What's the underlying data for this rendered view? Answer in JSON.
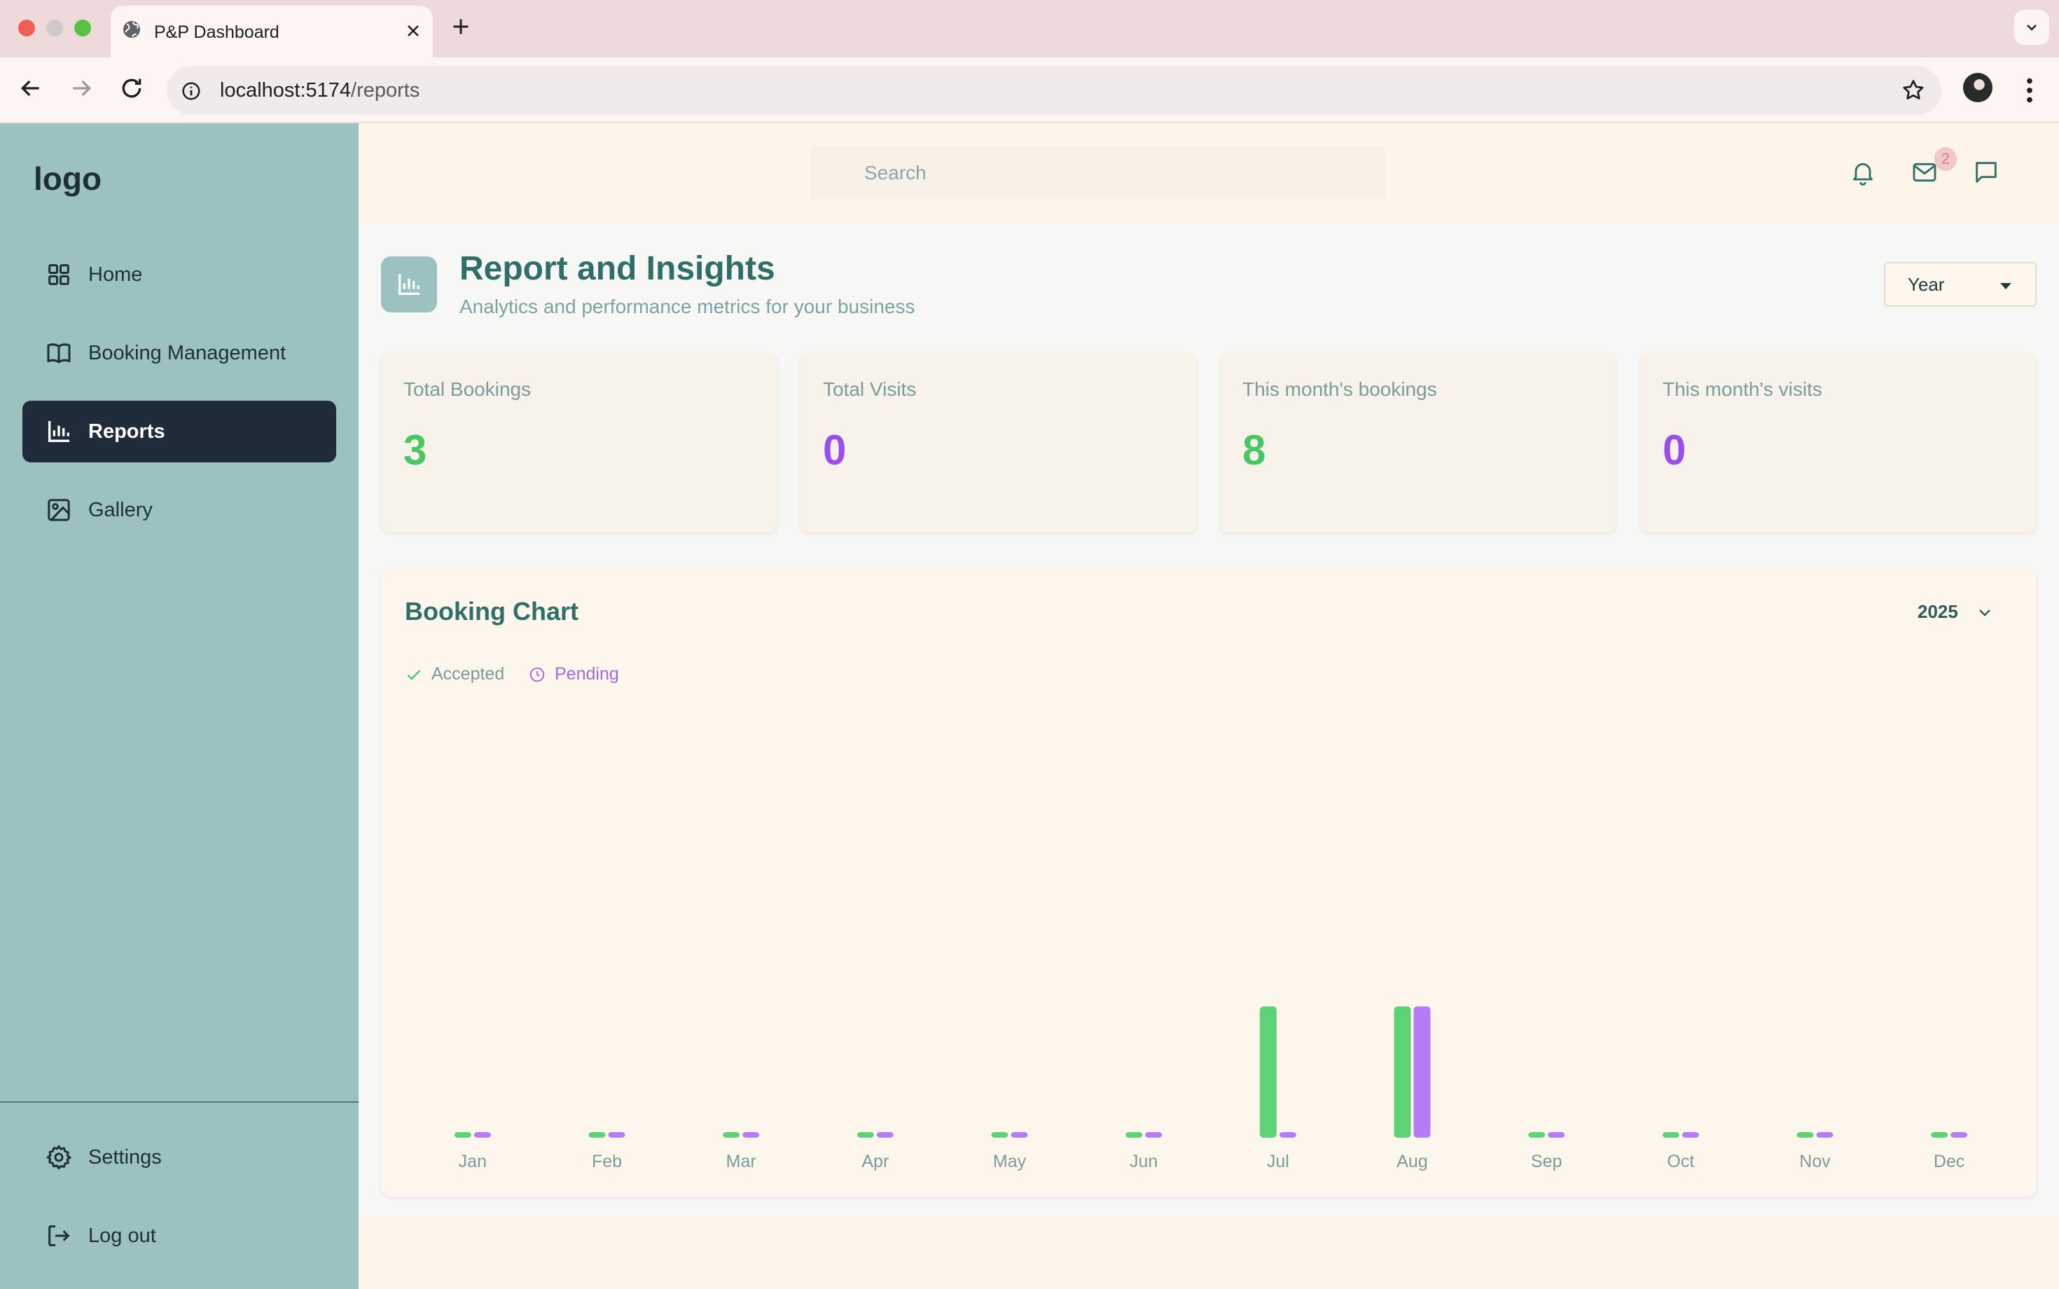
{
  "browser": {
    "tab_title": "P&P Dashboard",
    "url_host": "localhost:5174",
    "url_path": "/reports"
  },
  "sidebar": {
    "logo": "logo",
    "items": [
      {
        "label": "Home",
        "icon": "grid-icon"
      },
      {
        "label": "Booking Management",
        "icon": "book-icon"
      },
      {
        "label": "Reports",
        "icon": "bar-chart-icon",
        "active": true
      },
      {
        "label": "Gallery",
        "icon": "image-icon"
      }
    ],
    "bottom_items": [
      {
        "label": "Settings",
        "icon": "gear-icon"
      },
      {
        "label": "Log out",
        "icon": "logout-icon"
      }
    ]
  },
  "header": {
    "search_placeholder": "Search",
    "mail_badge": "2"
  },
  "page": {
    "title": "Report and Insights",
    "subtitle": "Analytics and performance metrics for your business",
    "period_select": "Year"
  },
  "stats": [
    {
      "label": "Total Bookings",
      "value": "3",
      "color": "#4cc663"
    },
    {
      "label": "Total Visits",
      "value": "0",
      "color": "#9a4ef0"
    },
    {
      "label": "This month's bookings",
      "value": "8",
      "color": "#4cc663"
    },
    {
      "label": "This month's visits",
      "value": "0",
      "color": "#9a4ef0"
    }
  ],
  "booking_chart": {
    "title": "Booking Chart",
    "year": "2025"
  },
  "colors": {
    "accepted": "#5cd376",
    "pending": "#b57cf5",
    "sidebar": "#9bc2c1",
    "active_nav": "#1f2b38",
    "heading": "#2f6f67"
  },
  "chart_data": {
    "type": "bar",
    "title": "",
    "categories": [
      "Jan",
      "Feb",
      "Mar",
      "Apr",
      "May",
      "Jun",
      "Jul",
      "Aug",
      "Sep",
      "Oct",
      "Nov",
      "Dec"
    ],
    "series": [
      {
        "name": "Accepted",
        "values": [
          0,
          0,
          0,
          0,
          0,
          0,
          2,
          2,
          0,
          0,
          0,
          0
        ]
      },
      {
        "name": "Pending",
        "values": [
          0,
          0,
          0,
          0,
          0,
          0,
          0,
          2,
          0,
          0,
          0,
          0
        ]
      }
    ],
    "ylim": [
      0,
      6
    ],
    "grid": false,
    "legend": "top-left"
  }
}
